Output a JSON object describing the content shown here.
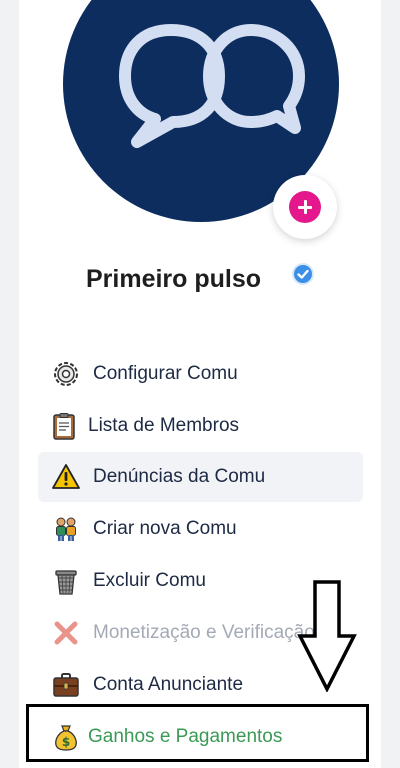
{
  "community": {
    "name": "Primeiro pulso"
  },
  "menu": [
    {
      "label": "Configurar Comu",
      "icon": "gear-icon"
    },
    {
      "label": "Lista de Membros",
      "icon": "clipboard-icon"
    },
    {
      "label": "Denúncias da Comu",
      "icon": "warning-icon"
    },
    {
      "label": "Criar nova Comu",
      "icon": "people-icon"
    },
    {
      "label": "Excluir Comu",
      "icon": "trash-icon"
    },
    {
      "label": "Monetização e Verificação",
      "icon": "cross-icon"
    },
    {
      "label": "Conta Anunciante",
      "icon": "briefcase-icon"
    },
    {
      "label": "Ganhos e Pagamentos",
      "icon": "money-bag-icon"
    }
  ],
  "colors": {
    "avatar_bg": "#0c2d5e",
    "add_button": "#e4188c",
    "verified_badge": "#3b8fe6",
    "earnings_text": "#3a9a55"
  }
}
